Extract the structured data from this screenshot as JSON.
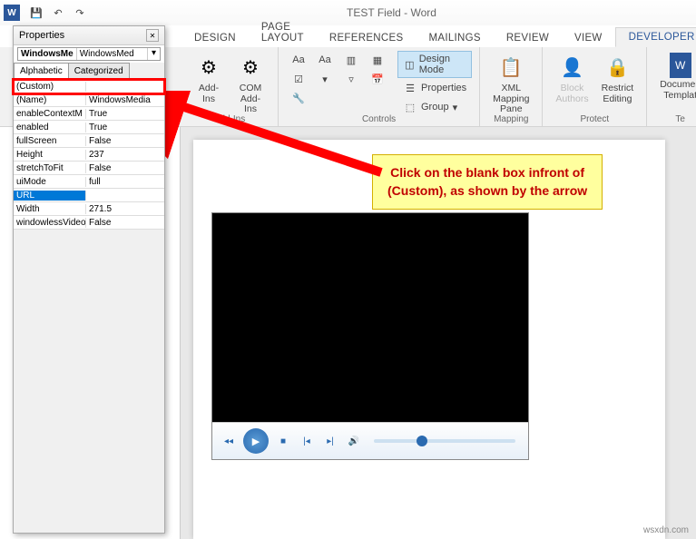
{
  "titlebar": {
    "doc_title": "TEST Field - Word"
  },
  "tabs": {
    "design": "DESIGN",
    "page_layout": "PAGE LAYOUT",
    "references": "REFERENCES",
    "mailings": "MAILINGS",
    "review": "REVIEW",
    "view": "VIEW",
    "developer": "DEVELOPER"
  },
  "ribbon": {
    "addins": {
      "addins": "Add-Ins",
      "com": "COM\nAdd-Ins",
      "group": "Add-Ins"
    },
    "controls": {
      "design_mode": "Design Mode",
      "properties": "Properties",
      "group_btn": "Group",
      "group": "Controls"
    },
    "mapping": {
      "xml": "XML Mapping\nPane",
      "group": "Mapping"
    },
    "protect": {
      "block": "Block\nAuthors",
      "restrict": "Restrict\nEditing",
      "group": "Protect"
    },
    "templates": {
      "doc": "Documen\nTemplat",
      "group": "Te"
    }
  },
  "properties": {
    "title": "Properties",
    "object_name": "WindowsMe",
    "object_type": "WindowsMed",
    "tab_alphabetic": "Alphabetic",
    "tab_categorized": "Categorized",
    "rows": [
      {
        "name": "(Custom)",
        "val": ""
      },
      {
        "name": "(Name)",
        "val": "WindowsMedia"
      },
      {
        "name": "enableContextM",
        "val": "True"
      },
      {
        "name": "enabled",
        "val": "True"
      },
      {
        "name": "fullScreen",
        "val": "False"
      },
      {
        "name": "Height",
        "val": "237"
      },
      {
        "name": "stretchToFit",
        "val": "False"
      },
      {
        "name": "uiMode",
        "val": "full"
      },
      {
        "name": "URL",
        "val": ""
      },
      {
        "name": "Width",
        "val": "271.5"
      },
      {
        "name": "windowlessVideo",
        "val": "False"
      }
    ]
  },
  "callout": {
    "line1": "Click on the blank box infront of",
    "line2": "(Custom), as shown by the arrow"
  },
  "watermark": "wsxdn.com"
}
